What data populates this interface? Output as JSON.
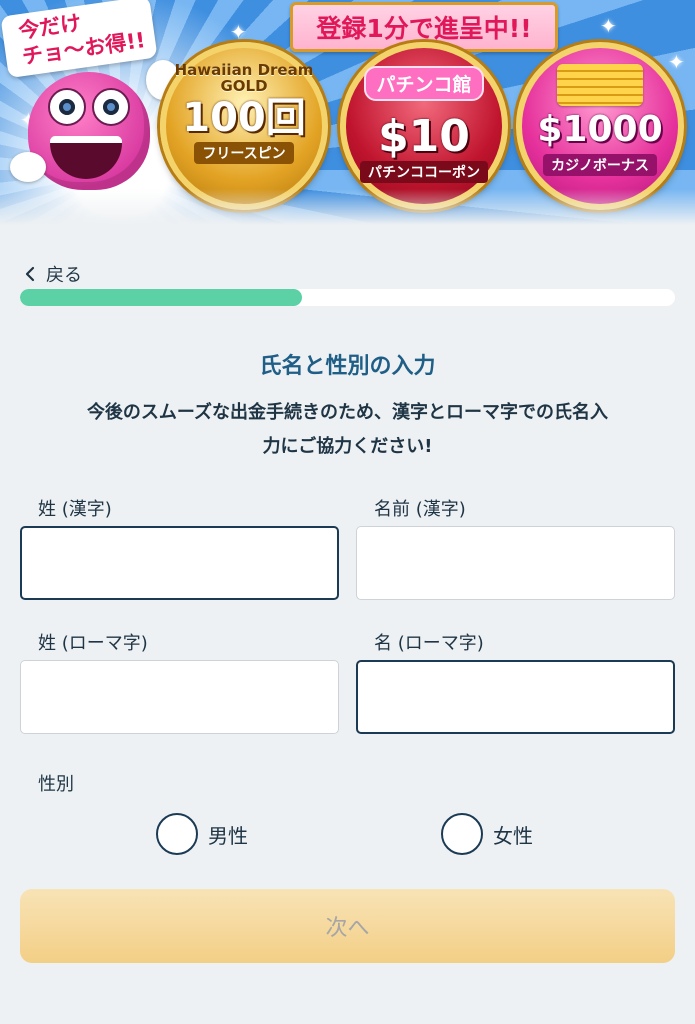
{
  "banner": {
    "promo_tag": "今だけ\nチョ〜お得!!",
    "ribbon": "登録1分で進呈中!!",
    "offers": [
      {
        "logo": "Hawaiian Dream GOLD",
        "amount": "100回",
        "sub": "フリースピン"
      },
      {
        "logo": "パチンコ館",
        "amount": "$10",
        "sub": "パチンココーポン"
      },
      {
        "logo": "",
        "amount": "$1000",
        "sub": "カジノボーナス"
      }
    ]
  },
  "nav": {
    "back_label": "戻る"
  },
  "progress": {
    "fraction": 0.43,
    "color": "#5bd1a5"
  },
  "form": {
    "title": "氏名と性別の入力",
    "subtitle_line1": "今後のスムーズな出金手続きのため、漢字とローマ字での氏名入",
    "subtitle_line2": "力にご協力ください!",
    "last_name_kanji": {
      "label": "姓 (漢字)",
      "value": ""
    },
    "first_name_kanji": {
      "label": "名前 (漢字)",
      "value": ""
    },
    "last_name_roman": {
      "label": "姓 (ローマ字)",
      "value": ""
    },
    "first_name_roman": {
      "label": "名 (ローマ字)",
      "value": ""
    },
    "gender": {
      "label": "性別",
      "options": [
        "男性",
        "女性"
      ]
    },
    "next_button": "次へ"
  },
  "colors": {
    "background": "#eef1f3",
    "accent": "#1f5e86",
    "progress": "#5bd1a5",
    "button": "#f3cf86"
  }
}
